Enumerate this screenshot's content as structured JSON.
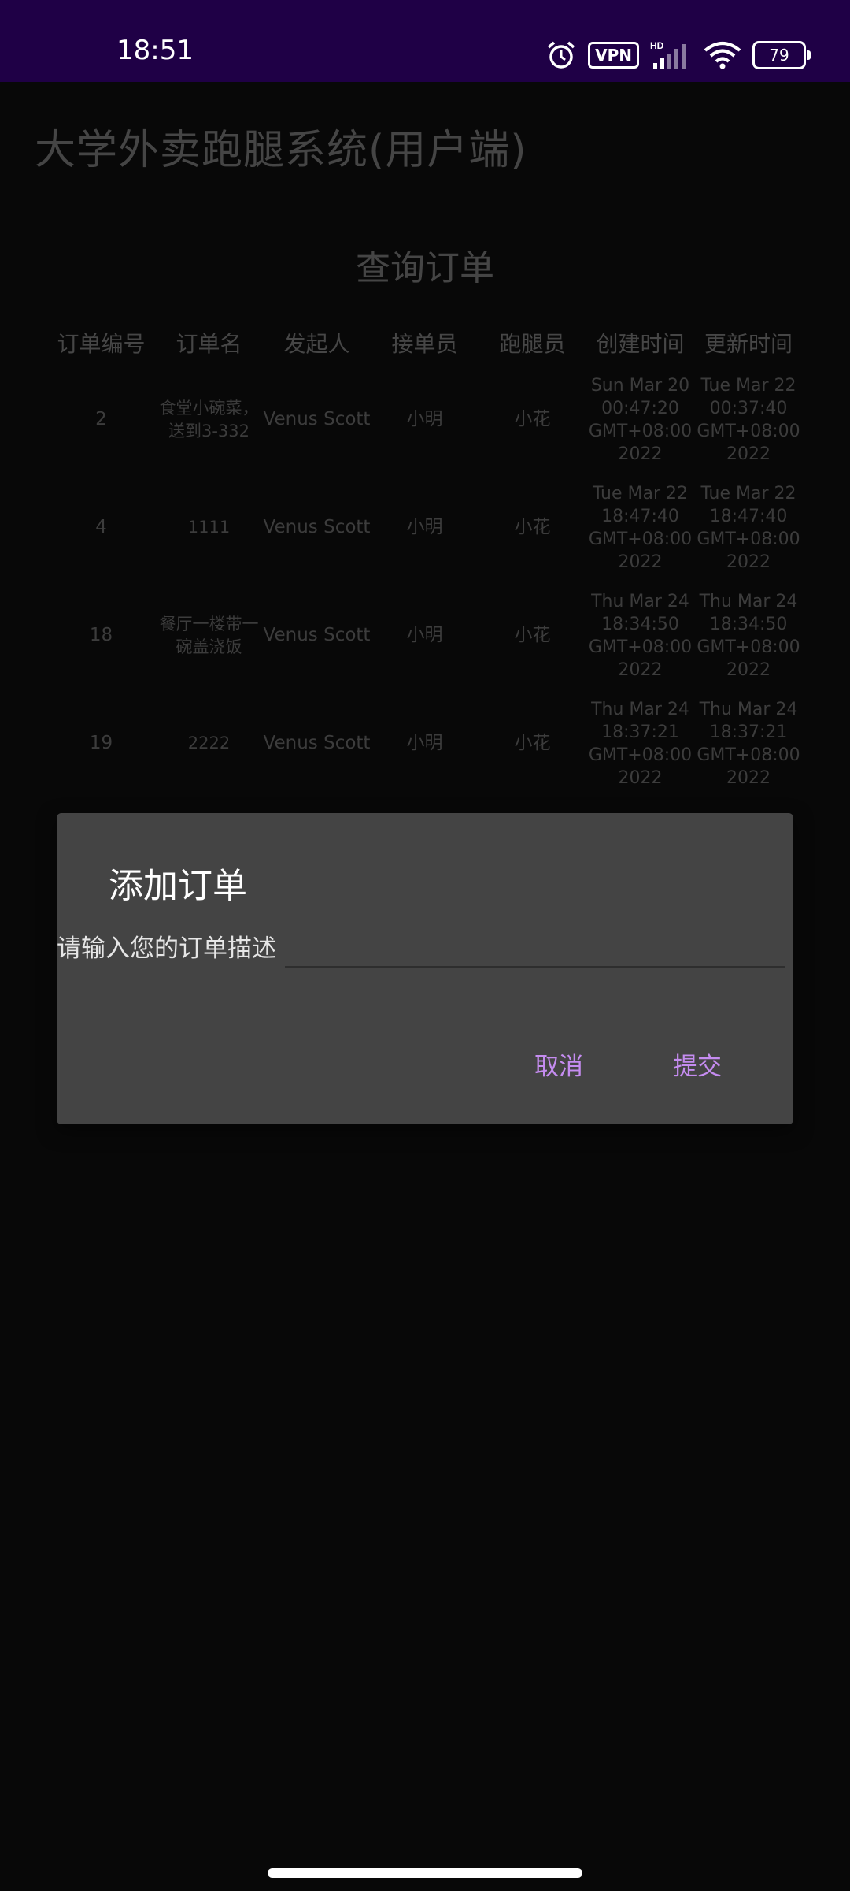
{
  "status_bar": {
    "time": "18:51",
    "icons": [
      "alarm-icon",
      "vpn-icon",
      "hd-signal-icon",
      "wifi-icon",
      "battery-icon"
    ],
    "vpn_label": "VPN",
    "hd_label": "HD",
    "battery": "79"
  },
  "app": {
    "title": "大学外卖跑腿系统(用户端)",
    "section_title": "查询订单"
  },
  "table": {
    "headers": [
      "订单编号",
      "订单名",
      "发起人",
      "接单员",
      "跑腿员",
      "创建时间",
      "更新时间"
    ],
    "rows": [
      [
        "2",
        "食堂小碗菜，送到3-332",
        "Venus Scott",
        "小明",
        "小花",
        "Sun Mar 20 00:47:20 GMT+08:00 2022",
        "Tue Mar 22 00:37:40 GMT+08:00 2022"
      ],
      [
        "4",
        "1111",
        "Venus Scott",
        "小明",
        "小花",
        "Tue Mar 22 18:47:40 GMT+08:00 2022",
        "Tue Mar 22 18:47:40 GMT+08:00 2022"
      ],
      [
        "18",
        "餐厅一楼带一碗盖浇饭",
        "Venus Scott",
        "小明",
        "小花",
        "Thu Mar 24 18:34:50 GMT+08:00 2022",
        "Thu Mar 24 18:34:50 GMT+08:00 2022"
      ],
      [
        "19",
        "2222",
        "Venus Scott",
        "小明",
        "小花",
        "Thu Mar 24 18:37:21 GMT+08:00 2022",
        "Thu Mar 24 18:37:21 GMT+08:00 2022"
      ]
    ]
  },
  "dialog": {
    "title": "添加订单",
    "label": "请输入您的订单描述",
    "input_value": "",
    "cancel_label": "取消",
    "submit_label": "提交"
  },
  "colors": {
    "status_bar_bg": "#1f0046",
    "background": "#080808",
    "dialog_bg": "#444444",
    "accent": "#c58cf0"
  }
}
